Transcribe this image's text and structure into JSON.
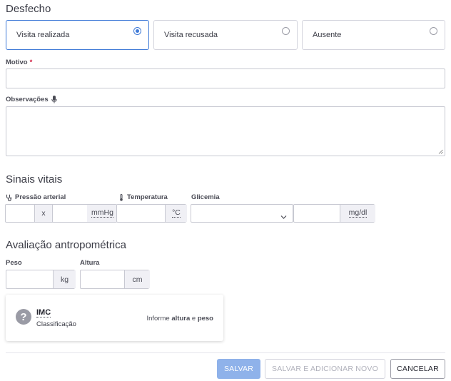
{
  "desfecho": {
    "title": "Desfecho",
    "options": [
      {
        "label": "Visita realizada",
        "selected": true
      },
      {
        "label": "Visita recusada",
        "selected": false
      },
      {
        "label": "Ausente",
        "selected": false
      }
    ]
  },
  "motivo": {
    "label": "Motivo",
    "required_mark": "*",
    "value": ""
  },
  "observacoes": {
    "label": "Observações",
    "icon": "microphone-icon",
    "value": ""
  },
  "sinais_vitais": {
    "title": "Sinais vitais",
    "pressao": {
      "label": "Pressão arterial",
      "icon": "stethoscope-icon",
      "separator": "x",
      "unit": "mmHg"
    },
    "temperatura": {
      "label": "Temperatura",
      "icon": "thermometer-icon",
      "unit": "°C"
    },
    "glicemia": {
      "label": "Glicemia",
      "select_value": "",
      "unit": "mg/dl"
    }
  },
  "antropometria": {
    "title": "Avaliação antropométrica",
    "peso": {
      "label": "Peso",
      "unit": "kg"
    },
    "altura": {
      "label": "Altura",
      "unit": "cm"
    },
    "imc": {
      "icon": "help-circle-icon",
      "title": "IMC",
      "subtitle": "Classificação",
      "hint_prefix": "Informe",
      "hint_altura": "altura",
      "hint_mid": "e",
      "hint_peso": "peso"
    }
  },
  "footer": {
    "salvar": "SALVAR",
    "salvar_novo": "SALVAR E ADICIONAR NOVO",
    "cancelar": "CANCELAR"
  },
  "colors": {
    "primary": "#3f7ad7",
    "primary_disabled": "#8fb2ea",
    "required": "#d0193e"
  }
}
